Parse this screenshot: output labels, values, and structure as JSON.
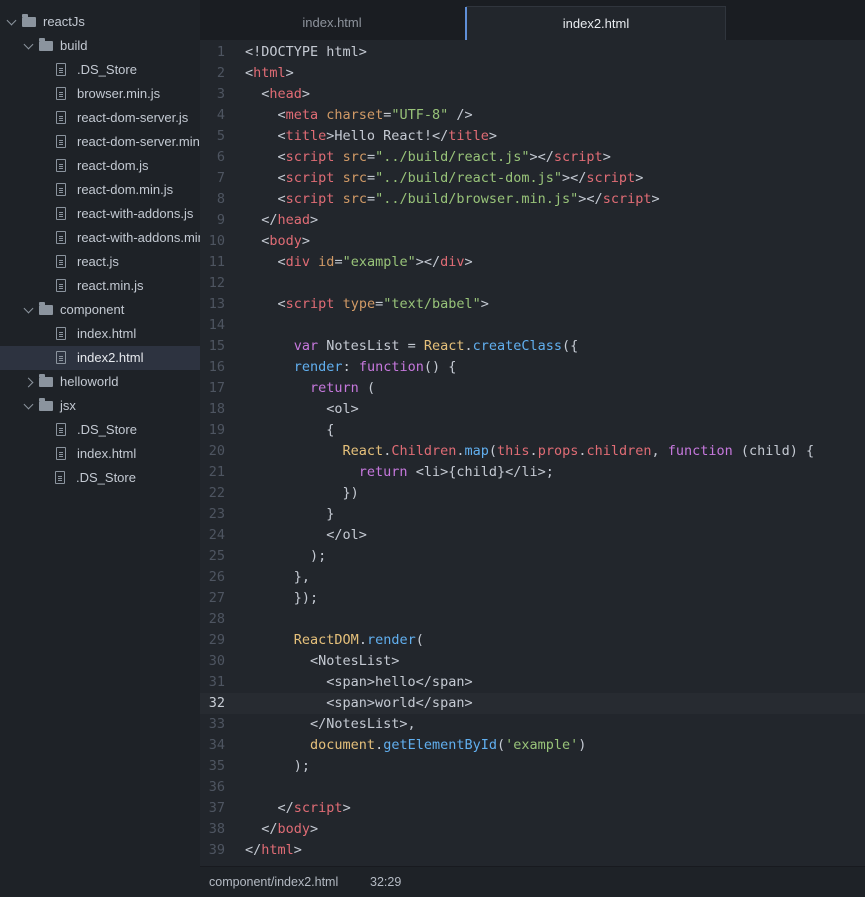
{
  "sidebar": {
    "items": [
      {
        "label": "reactJs",
        "type": "folder",
        "depth": 0,
        "expanded": true
      },
      {
        "label": "build",
        "type": "folder",
        "depth": 1,
        "expanded": true
      },
      {
        "label": ".DS_Store",
        "type": "file",
        "depth": 2
      },
      {
        "label": "browser.min.js",
        "type": "file",
        "depth": 2
      },
      {
        "label": "react-dom-server.js",
        "type": "file",
        "depth": 2
      },
      {
        "label": "react-dom-server.min.js",
        "type": "file",
        "depth": 2
      },
      {
        "label": "react-dom.js",
        "type": "file",
        "depth": 2
      },
      {
        "label": "react-dom.min.js",
        "type": "file",
        "depth": 2
      },
      {
        "label": "react-with-addons.js",
        "type": "file",
        "depth": 2
      },
      {
        "label": "react-with-addons.min.js",
        "type": "file",
        "depth": 2
      },
      {
        "label": "react.js",
        "type": "file",
        "depth": 2
      },
      {
        "label": "react.min.js",
        "type": "file",
        "depth": 2
      },
      {
        "label": "component",
        "type": "folder",
        "depth": 1,
        "expanded": true
      },
      {
        "label": "index.html",
        "type": "file",
        "depth": 2
      },
      {
        "label": "index2.html",
        "type": "file",
        "depth": 2,
        "selected": true
      },
      {
        "label": "helloworld",
        "type": "folder",
        "depth": 1,
        "expanded": false
      },
      {
        "label": "jsx",
        "type": "folder",
        "depth": 1,
        "expanded": true
      },
      {
        "label": ".DS_Store",
        "type": "file",
        "depth": 2
      },
      {
        "label": "index.html",
        "type": "file",
        "depth": 2
      },
      {
        "label": ".DS_Store",
        "type": "file",
        "depth": 1
      }
    ]
  },
  "tabs": [
    {
      "label": "index.html",
      "active": false
    },
    {
      "label": "index2.html",
      "active": true
    }
  ],
  "editor": {
    "current_line": 32,
    "lines": [
      [
        [
          "pl",
          "<!DOCTYPE html>"
        ]
      ],
      [
        [
          "pl",
          "<"
        ],
        [
          "tag",
          "html"
        ],
        [
          "pl",
          ">"
        ]
      ],
      [
        [
          "pl",
          "  <"
        ],
        [
          "tag",
          "head"
        ],
        [
          "pl",
          ">"
        ]
      ],
      [
        [
          "pl",
          "    <"
        ],
        [
          "tag",
          "meta"
        ],
        [
          "pl",
          " "
        ],
        [
          "attr",
          "charset"
        ],
        [
          "pl",
          "="
        ],
        [
          "str",
          "\"UTF-8\""
        ],
        [
          "pl",
          " />"
        ]
      ],
      [
        [
          "pl",
          "    <"
        ],
        [
          "tag",
          "title"
        ],
        [
          "pl",
          ">Hello React!</"
        ],
        [
          "tag",
          "title"
        ],
        [
          "pl",
          ">"
        ]
      ],
      [
        [
          "pl",
          "    <"
        ],
        [
          "tag",
          "script"
        ],
        [
          "pl",
          " "
        ],
        [
          "attr",
          "src"
        ],
        [
          "pl",
          "="
        ],
        [
          "str",
          "\"../build/react.js\""
        ],
        [
          "pl",
          "></"
        ],
        [
          "tag",
          "script"
        ],
        [
          "pl",
          ">"
        ]
      ],
      [
        [
          "pl",
          "    <"
        ],
        [
          "tag",
          "script"
        ],
        [
          "pl",
          " "
        ],
        [
          "attr",
          "src"
        ],
        [
          "pl",
          "="
        ],
        [
          "str",
          "\"../build/react-dom.js\""
        ],
        [
          "pl",
          "></"
        ],
        [
          "tag",
          "script"
        ],
        [
          "pl",
          ">"
        ]
      ],
      [
        [
          "pl",
          "    <"
        ],
        [
          "tag",
          "script"
        ],
        [
          "pl",
          " "
        ],
        [
          "attr",
          "src"
        ],
        [
          "pl",
          "="
        ],
        [
          "str",
          "\"../build/browser.min.js\""
        ],
        [
          "pl",
          "></"
        ],
        [
          "tag",
          "script"
        ],
        [
          "pl",
          ">"
        ]
      ],
      [
        [
          "pl",
          "  </"
        ],
        [
          "tag",
          "head"
        ],
        [
          "pl",
          ">"
        ]
      ],
      [
        [
          "pl",
          "  <"
        ],
        [
          "tag",
          "body"
        ],
        [
          "pl",
          ">"
        ]
      ],
      [
        [
          "pl",
          "    <"
        ],
        [
          "tag",
          "div"
        ],
        [
          "pl",
          " "
        ],
        [
          "attr",
          "id"
        ],
        [
          "pl",
          "="
        ],
        [
          "str",
          "\"example\""
        ],
        [
          "pl",
          "></"
        ],
        [
          "tag",
          "div"
        ],
        [
          "pl",
          ">"
        ]
      ],
      [
        [
          "pl",
          ""
        ]
      ],
      [
        [
          "pl",
          "    <"
        ],
        [
          "tag",
          "script"
        ],
        [
          "pl",
          " "
        ],
        [
          "attr",
          "type"
        ],
        [
          "pl",
          "="
        ],
        [
          "str",
          "\"text/babel\""
        ],
        [
          "pl",
          ">"
        ]
      ],
      [
        [
          "pl",
          ""
        ]
      ],
      [
        [
          "pl",
          "      "
        ],
        [
          "kw",
          "var"
        ],
        [
          "pl",
          " NotesList = "
        ],
        [
          "obj",
          "React"
        ],
        [
          "pl",
          "."
        ],
        [
          "fn",
          "createClass"
        ],
        [
          "pl",
          "({"
        ]
      ],
      [
        [
          "pl",
          "      "
        ],
        [
          "fn",
          "render"
        ],
        [
          "pl",
          ": "
        ],
        [
          "kw",
          "function"
        ],
        [
          "pl",
          "() {"
        ]
      ],
      [
        [
          "pl",
          "        "
        ],
        [
          "kw",
          "return"
        ],
        [
          "pl",
          " ("
        ]
      ],
      [
        [
          "pl",
          "          <ol>"
        ]
      ],
      [
        [
          "pl",
          "          {"
        ]
      ],
      [
        [
          "pl",
          "            "
        ],
        [
          "obj",
          "React"
        ],
        [
          "pl",
          "."
        ],
        [
          "prop",
          "Children"
        ],
        [
          "pl",
          "."
        ],
        [
          "fn",
          "map"
        ],
        [
          "pl",
          "("
        ],
        [
          "prop",
          "this"
        ],
        [
          "pl",
          "."
        ],
        [
          "prop",
          "props"
        ],
        [
          "pl",
          "."
        ],
        [
          "prop",
          "children"
        ],
        [
          "pl",
          ", "
        ],
        [
          "kw",
          "function"
        ],
        [
          "pl",
          " (child) {"
        ]
      ],
      [
        [
          "pl",
          "              "
        ],
        [
          "kw",
          "return"
        ],
        [
          "pl",
          " <li>{child}</li>;"
        ]
      ],
      [
        [
          "pl",
          "            })"
        ]
      ],
      [
        [
          "pl",
          "          }"
        ]
      ],
      [
        [
          "pl",
          "          </ol>"
        ]
      ],
      [
        [
          "pl",
          "        );"
        ]
      ],
      [
        [
          "pl",
          "      },"
        ]
      ],
      [
        [
          "pl",
          "      });"
        ]
      ],
      [
        [
          "pl",
          ""
        ]
      ],
      [
        [
          "pl",
          "      "
        ],
        [
          "obj",
          "ReactDOM"
        ],
        [
          "pl",
          "."
        ],
        [
          "fn",
          "render"
        ],
        [
          "pl",
          "("
        ]
      ],
      [
        [
          "pl",
          "        <NotesList>"
        ]
      ],
      [
        [
          "pl",
          "          <span>hello</span>"
        ]
      ],
      [
        [
          "pl",
          "          <span>world</span>"
        ]
      ],
      [
        [
          "pl",
          "        </NotesList>,"
        ]
      ],
      [
        [
          "pl",
          "        "
        ],
        [
          "obj",
          "document"
        ],
        [
          "pl",
          "."
        ],
        [
          "fn",
          "getElementById"
        ],
        [
          "pl",
          "("
        ],
        [
          "str",
          "'example'"
        ],
        [
          "pl",
          ")"
        ]
      ],
      [
        [
          "pl",
          "      );"
        ]
      ],
      [
        [
          "pl",
          ""
        ]
      ],
      [
        [
          "pl",
          "    </"
        ],
        [
          "tag",
          "script"
        ],
        [
          "pl",
          ">"
        ]
      ],
      [
        [
          "pl",
          "  </"
        ],
        [
          "tag",
          "body"
        ],
        [
          "pl",
          ">"
        ]
      ],
      [
        [
          "pl",
          "</"
        ],
        [
          "tag",
          "html"
        ],
        [
          "pl",
          ">"
        ]
      ]
    ]
  },
  "statusbar": {
    "path": "component/index2.html",
    "cursor": "32:29"
  }
}
